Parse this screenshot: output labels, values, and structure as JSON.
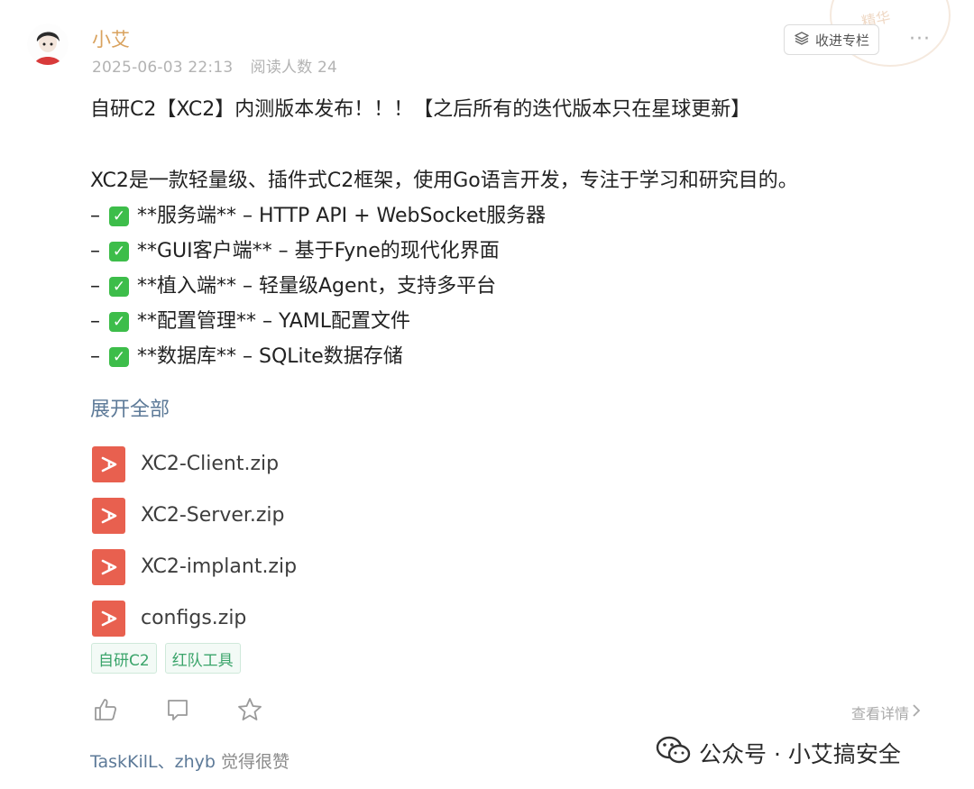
{
  "header": {
    "author": "小艾",
    "date": "2025-06-03 22:13",
    "read_count": "阅读人数 24",
    "collect_label": "收进专栏",
    "more_label": "···",
    "stamp_text": "精华"
  },
  "post": {
    "title": "自研C2【XC2】内测版本发布！！！【之后所有的迭代版本只在星球更新】",
    "intro": "XC2是一款轻量级、插件式C2框架，使用Go语言开发，专注于学习和研究目的。",
    "features": [
      {
        "dash": "–",
        "text": "**服务端** – HTTP API + WebSocket服务器"
      },
      {
        "dash": "–",
        "text": "**GUI客户端** – 基于Fyne的现代化界面"
      },
      {
        "dash": "–",
        "text": "**植入端** – 轻量级Agent，支持多平台"
      },
      {
        "dash": "–",
        "text": "**配置管理** – YAML配置文件"
      },
      {
        "dash": "–",
        "text": "**数据库** – SQLite数据存储"
      }
    ],
    "expand_label": "展开全部"
  },
  "attachments": [
    {
      "name": "XC2-Client.zip"
    },
    {
      "name": "XC2-Server.zip"
    },
    {
      "name": "XC2-implant.zip"
    },
    {
      "name": "configs.zip"
    }
  ],
  "tags": [
    "自研C2",
    "红队工具"
  ],
  "footer": {
    "details_label": "查看详情",
    "likes_names": "TaskKilL、zhyb",
    "likes_suffix": " 觉得很赞"
  },
  "watermark": {
    "text": "公众号 · 小艾搞安全"
  },
  "icons": {
    "collect": "layers-icon",
    "check": "check-mark-icon",
    "file": "file-icon",
    "like": "thumbs-up-icon",
    "comment": "comment-icon",
    "star": "star-icon",
    "chevron": "chevron-right-icon",
    "wechat": "wechat-icon"
  },
  "colors": {
    "author": "#d9a25e",
    "link": "#5d7a98",
    "tag_text": "#3aa46a",
    "file_icon": "#e8604f",
    "check_bg": "#3dbd4a"
  }
}
